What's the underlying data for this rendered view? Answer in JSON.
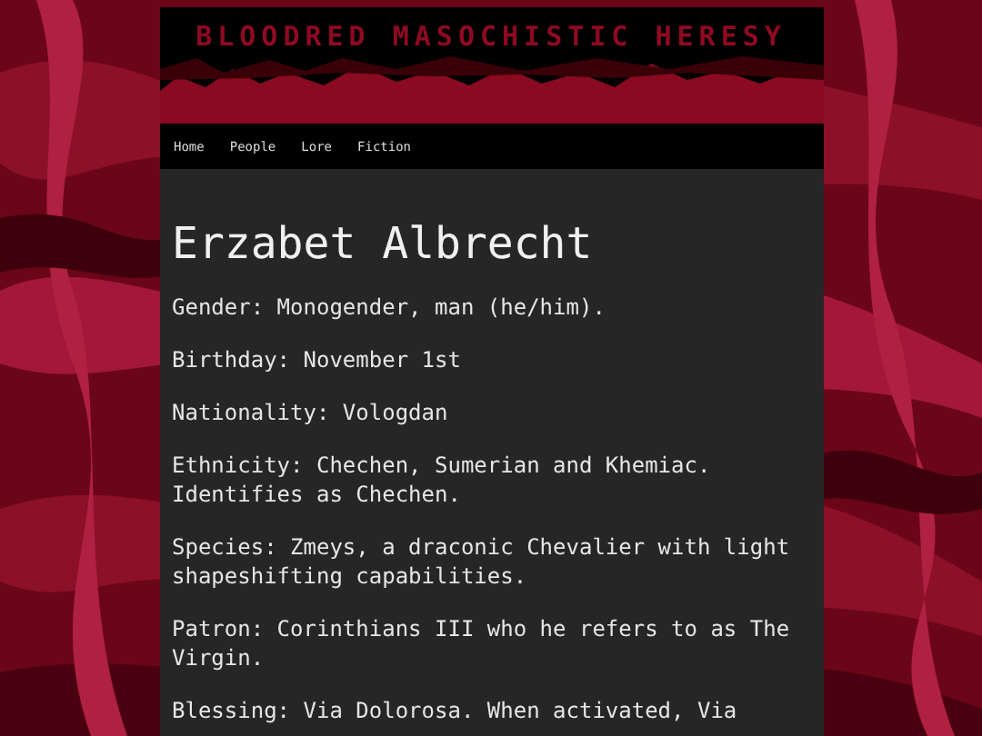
{
  "header": {
    "title": "BLOODRED MASOCHISTIC HERESY"
  },
  "nav": [
    {
      "label": "Home"
    },
    {
      "label": "People"
    },
    {
      "label": "Lore"
    },
    {
      "label": "Fiction"
    }
  ],
  "article": {
    "heading": "Erzabet Albrecht",
    "paragraphs": [
      "Gender: Monogender, man (he/him).",
      "Birthday: November 1st",
      "Nationality: Vologdan",
      "Ethnicity: Chechen, Sumerian and Khemiac. Identifies as Chechen.",
      "Species: Zmeys, a draconic Chevalier with light shapeshifting capabilities.",
      "Patron: Corinthians III who he refers to as The Virgin.",
      "Blessing: Via Dolorosa. When activated, Via"
    ]
  }
}
